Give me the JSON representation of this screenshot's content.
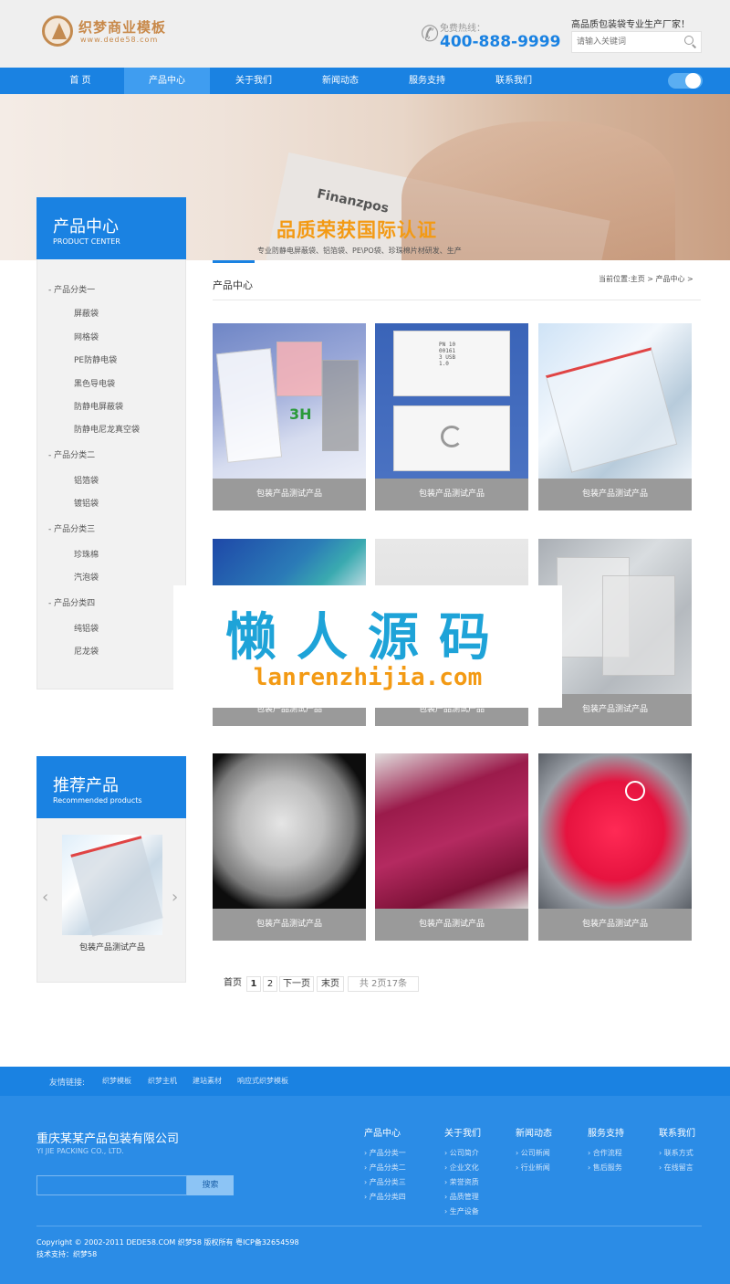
{
  "brand": {
    "logo_text": "织梦商业模板",
    "logo_sub": "www.dede58.com"
  },
  "header": {
    "hotline_label": "免费热线：",
    "hotline_number": "400-888-9999",
    "tagline": "高品质包装袋专业生产厂家！",
    "search_placeholder": "请输入关键词"
  },
  "nav": {
    "items": [
      {
        "label": "首 页"
      },
      {
        "label": "产品中心"
      },
      {
        "label": "关于我们"
      },
      {
        "label": "新闻动态"
      },
      {
        "label": "服务支持"
      },
      {
        "label": "联系我们"
      }
    ],
    "active_index": 1
  },
  "banner": {
    "title": "品质荣获国际认证",
    "subtitle": "专业防静电屏蔽袋、铝箔袋、PE\\PO袋、珍珠棉片材研发、生产",
    "stamp_text": "Finanzpos"
  },
  "sidebar": {
    "product_center_title": "产品中心",
    "product_center_sub": "PRODUCT CENTER",
    "categories": [
      {
        "title": "产品分类一",
        "items": [
          "屏蔽袋",
          "网格袋",
          "PE防静电袋",
          "黑色导电袋",
          "防静电屏蔽袋",
          "防静电尼龙真空袋"
        ]
      },
      {
        "title": "产品分类二",
        "items": [
          "铝箔袋",
          "镀铝袋"
        ]
      },
      {
        "title": "产品分类三",
        "items": [
          "珍珠棉",
          "汽泡袋"
        ]
      },
      {
        "title": "产品分类四",
        "items": [
          "纯铝袋",
          "尼龙袋"
        ]
      }
    ],
    "recommend_title": "推荐产品",
    "recommend_sub": "Recommended products",
    "recommend_caption": "包装产品测试产品"
  },
  "main": {
    "title": "产品中心",
    "breadcrumb": "当前位置:主页 > 产品中心 >",
    "products": [
      {
        "caption": "包装产品测试产品"
      },
      {
        "caption": "包装产品测试产品"
      },
      {
        "caption": "包装产品测试产品"
      },
      {
        "caption": "包装产品测试产品"
      },
      {
        "caption": "包装产品测试产品"
      },
      {
        "caption": "包装产品测试产品"
      },
      {
        "caption": "包装产品测试产品"
      },
      {
        "caption": "包装产品测试产品"
      },
      {
        "caption": "包装产品测试产品"
      }
    ],
    "product_tag_3h": "3H",
    "product_code": "PN 10001613 USB 1.0"
  },
  "pagination": {
    "first": "首页",
    "page1": "1",
    "page2": "2",
    "next": "下一页",
    "last": "末页",
    "summary": "共 2页17条"
  },
  "watermark": {
    "title": "懒人源码",
    "url": "lanrenzhijia.com"
  },
  "friend_links": {
    "label": "友情链接:",
    "items": [
      "织梦模板",
      "织梦主机",
      "建站素材",
      "响应式织梦模板"
    ]
  },
  "footer": {
    "company": "重庆某某产品包装有限公司",
    "company_en": "YI JIE PACKING CO., LTD.",
    "search_button": "搜索",
    "columns": [
      {
        "title": "产品中心",
        "items": [
          "产品分类一",
          "产品分类二",
          "产品分类三",
          "产品分类四"
        ]
      },
      {
        "title": "关于我们",
        "items": [
          "公司简介",
          "企业文化",
          "荣誉资质",
          "品质管理",
          "生产设备"
        ]
      },
      {
        "title": "新闻动态",
        "items": [
          "公司新闻",
          "行业新闻"
        ]
      },
      {
        "title": "服务支持",
        "items": [
          "合作流程",
          "售后服务"
        ]
      },
      {
        "title": "联系我们",
        "items": [
          "联系方式",
          "在线留言"
        ]
      }
    ],
    "copyright": "Copyright © 2002-2011 DEDE58.COM 织梦58 版权所有 粤ICP备32654598",
    "tech_support": "技术支持：织梦58"
  },
  "colors": {
    "primary": "#1a82e2",
    "accent_orange": "#f39a14",
    "gold": "#c8894a",
    "caption_gray": "#9a9a9a"
  }
}
